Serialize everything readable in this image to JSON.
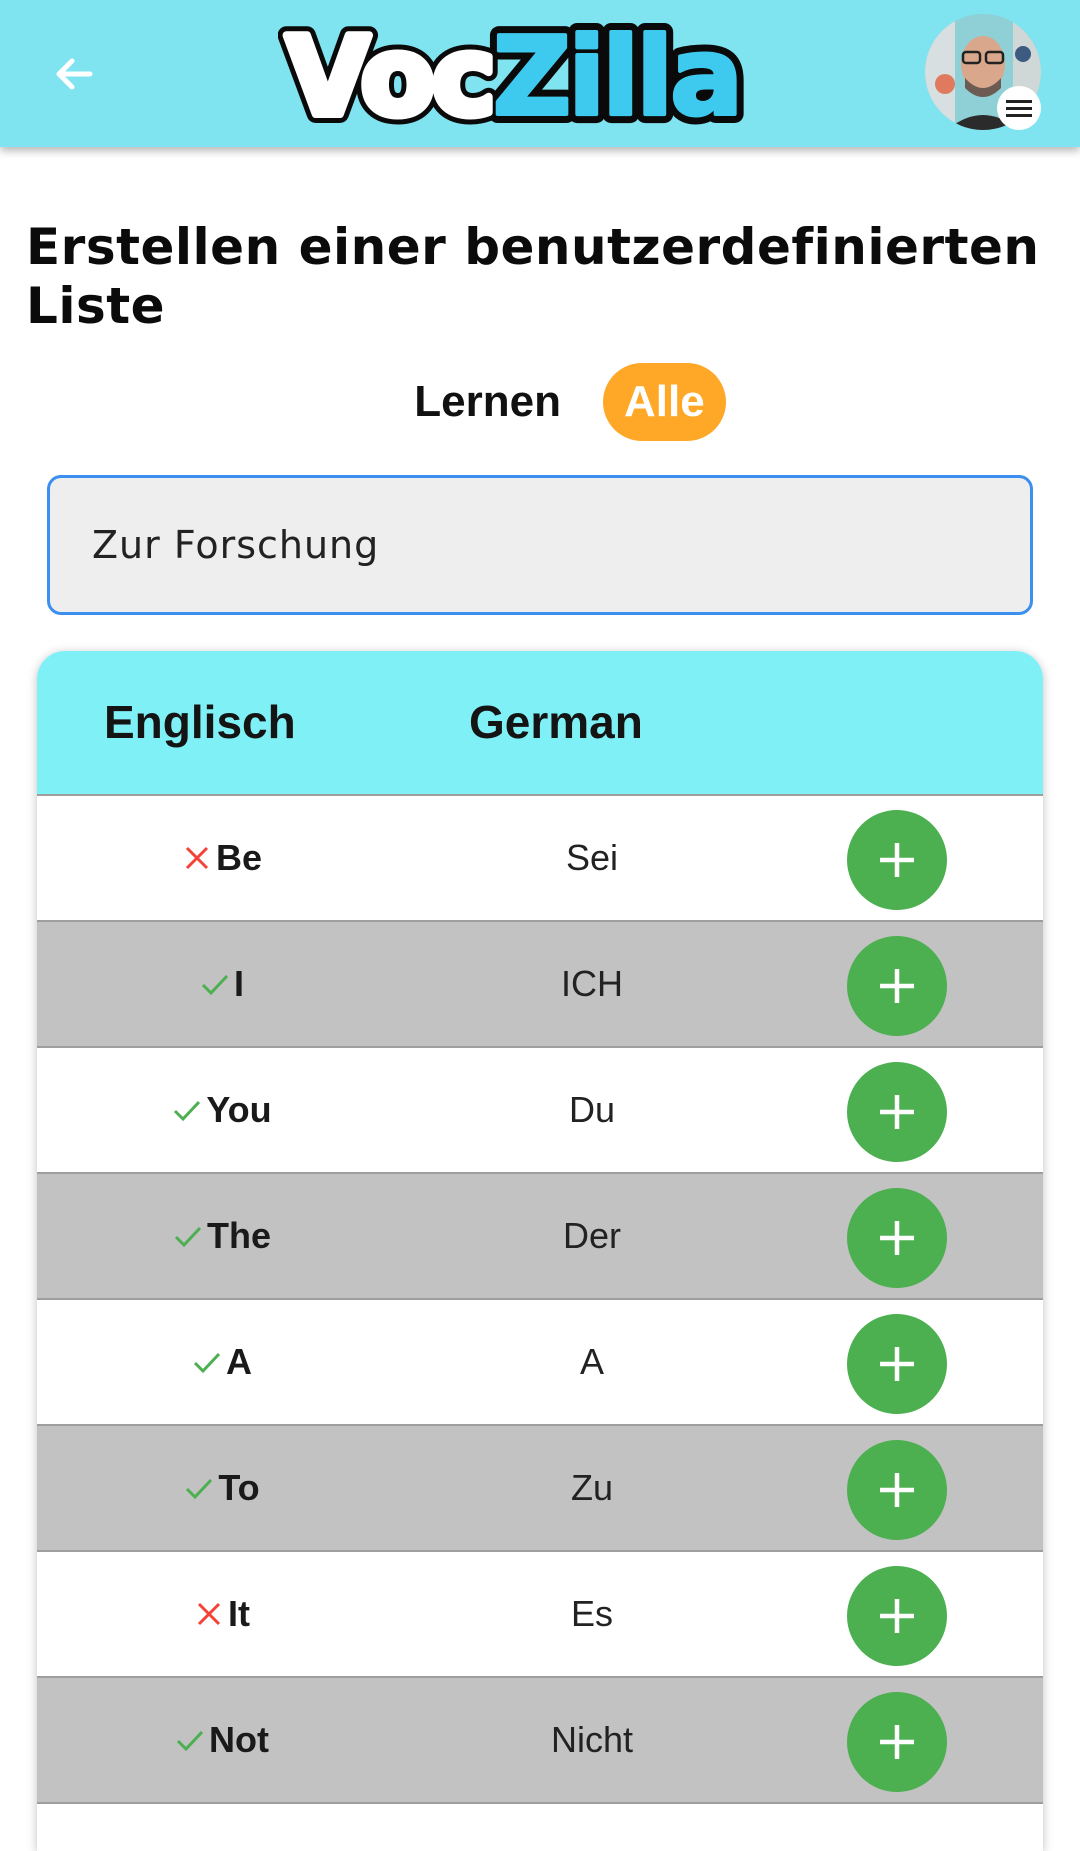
{
  "appbar": {
    "logo_part1": "Voc",
    "logo_part2": "Zilla",
    "colors": {
      "bar": "#7fe3f0",
      "logo_accent": "#3ec9ee"
    }
  },
  "page": {
    "title": "Erstellen einer benutzerdefinierten Liste"
  },
  "toggle": {
    "learn_label": "Lernen",
    "all_label": "Alle",
    "active": "Alle",
    "active_color": "#ffa726"
  },
  "list_name": {
    "value": "Zur Forschung"
  },
  "table": {
    "col_en": "Englisch",
    "col_de": "German",
    "rows": [
      {
        "en": "Be",
        "de": "Sei",
        "status": "wrong"
      },
      {
        "en": "I",
        "de": "ICH",
        "status": "correct"
      },
      {
        "en": "You",
        "de": "Du",
        "status": "correct"
      },
      {
        "en": "The",
        "de": "Der",
        "status": "correct"
      },
      {
        "en": "A",
        "de": "A",
        "status": "correct"
      },
      {
        "en": "To",
        "de": "Zu",
        "status": "correct"
      },
      {
        "en": "It",
        "de": "Es",
        "status": "wrong"
      },
      {
        "en": "Not",
        "de": "Nicht",
        "status": "correct"
      }
    ],
    "colors": {
      "header": "#7ff0f5",
      "alt_row": "#c2c2c2",
      "add_button": "#4caf50",
      "correct": "#4caf50",
      "wrong": "#f44336"
    }
  }
}
